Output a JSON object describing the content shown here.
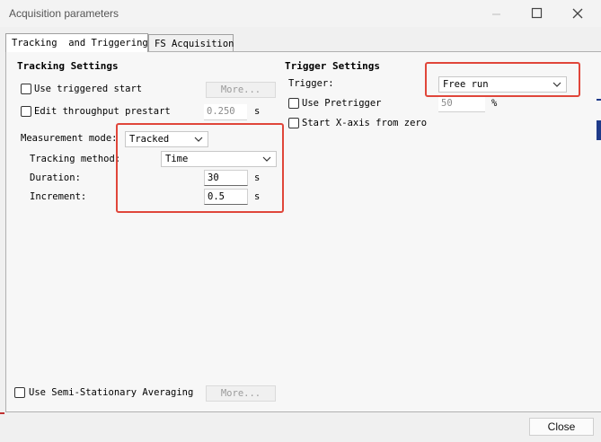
{
  "window": {
    "title": "Acquisition parameters"
  },
  "tabs": {
    "tracking": "Tracking  and Triggering",
    "fs": "FS Acquisition"
  },
  "tracking_settings": {
    "heading": "Tracking Settings",
    "use_triggered_start": {
      "label": "Use triggered start",
      "checked": false,
      "more_label": "More..."
    },
    "edit_throughput": {
      "label": "Edit throughput prestart",
      "value": "0.250",
      "unit": "s"
    },
    "measurement_mode": {
      "label": "Measurement mode:",
      "value": "Tracked"
    },
    "tracking_method": {
      "label": "Tracking method:",
      "value": "Time"
    },
    "duration": {
      "label": "Duration:",
      "value": "30",
      "unit": "s"
    },
    "increment": {
      "label": "Increment:",
      "value": "0.5",
      "unit": "s"
    }
  },
  "trigger_settings": {
    "heading": "Trigger Settings",
    "trigger": {
      "label": "Trigger:",
      "value": "Free run"
    },
    "use_pretrigger": {
      "label": "Use Pretrigger",
      "value": "50",
      "unit": "%"
    },
    "start_x_axis": {
      "label": "Start X-axis from zero"
    }
  },
  "semi_stationary": {
    "label": "Use Semi-Stationary Averaging",
    "more_label": "More..."
  },
  "footer": {
    "close_label": "Close"
  },
  "colors": {
    "highlight": "#e0463a",
    "window_bg": "#f0f0f0"
  }
}
